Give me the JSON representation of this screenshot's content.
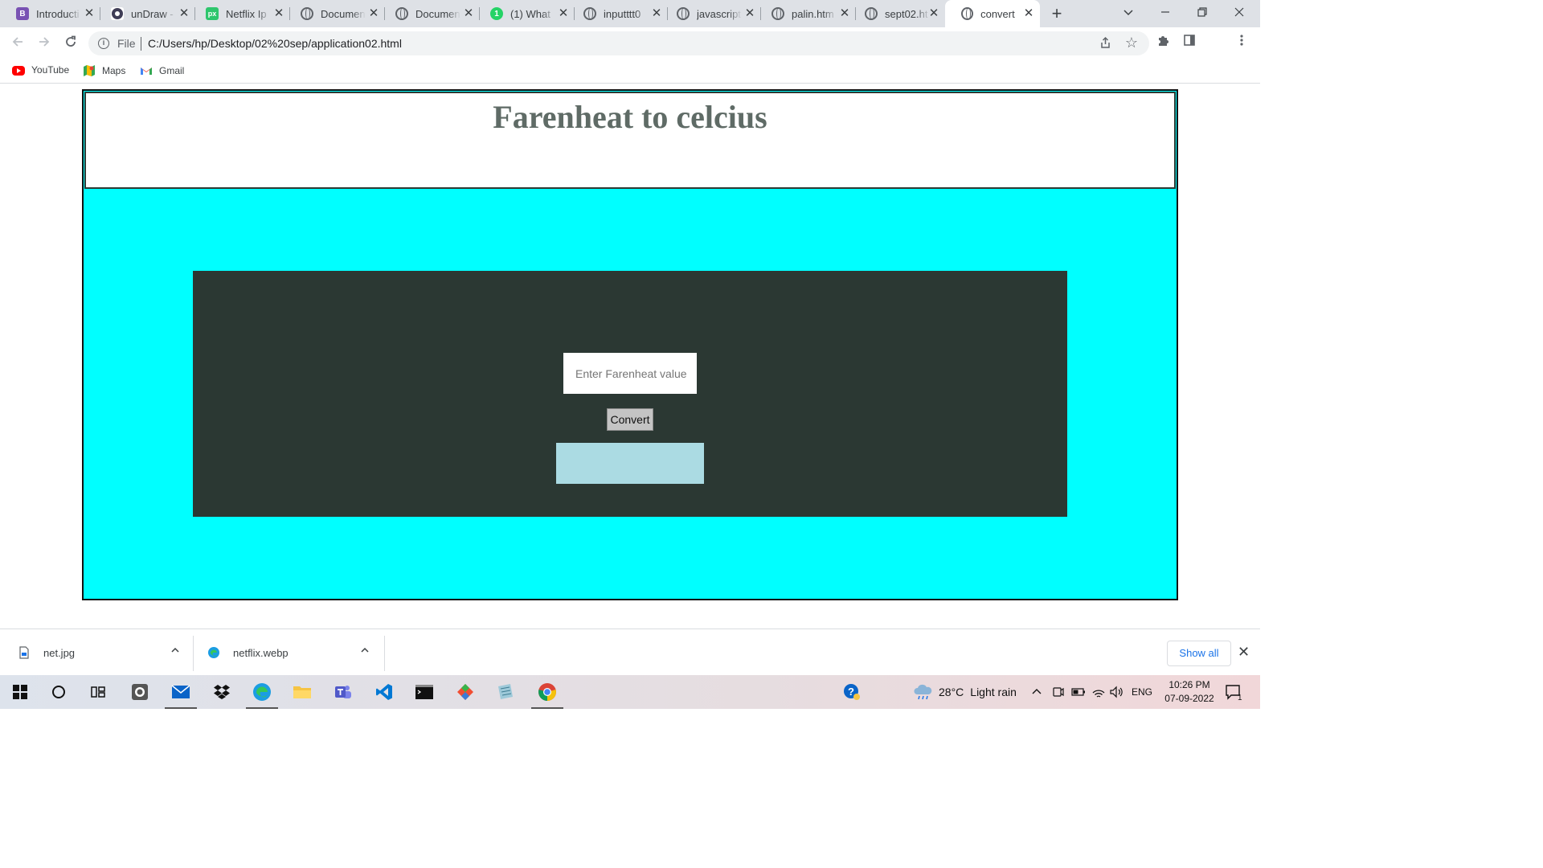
{
  "browser": {
    "tabs": [
      {
        "label": "Introducti",
        "icon": "bootstrap-icon",
        "color": "#7952b3"
      },
      {
        "label": "unDraw -",
        "icon": "undraw-icon",
        "color": "#3f3d56"
      },
      {
        "label": "Netflix Ip",
        "icon": "pixabay-icon",
        "color": "#2ec66d"
      },
      {
        "label": "Documen",
        "icon": "globe-icon"
      },
      {
        "label": "Documen",
        "icon": "globe-icon"
      },
      {
        "label": "(1) What",
        "icon": "whatsapp-icon",
        "color": "#25d366"
      },
      {
        "label": "inputttt0",
        "icon": "globe-icon"
      },
      {
        "label": "javascript",
        "icon": "globe-icon"
      },
      {
        "label": "palin.htm",
        "icon": "globe-icon"
      },
      {
        "label": "sept02.ht",
        "icon": "globe-icon"
      },
      {
        "label": "convert",
        "icon": "globe-icon",
        "active": true
      }
    ],
    "address": {
      "scheme_label": "File",
      "url": "C:/Users/hp/Desktop/02%20sep/application02.html"
    },
    "bookmarks": [
      {
        "label": "YouTube",
        "icon": "youtube-icon"
      },
      {
        "label": "Maps",
        "icon": "maps-icon"
      },
      {
        "label": "Gmail",
        "icon": "gmail-icon"
      }
    ]
  },
  "app": {
    "heading": "Farenheat to celcius",
    "input_placeholder": "Enter Farenheat value",
    "input_value": "",
    "convert_label": "Convert",
    "result_text": "",
    "colors": {
      "page_bg": "#00ffff",
      "panel_bg": "#2b3833",
      "heading_color": "#5f6b66",
      "result_bg": "#abdbe3"
    }
  },
  "downloads": {
    "items": [
      {
        "label": "net.jpg",
        "icon": "file-icon"
      },
      {
        "label": "netflix.webp",
        "icon": "edge-icon"
      }
    ],
    "show_all_label": "Show all"
  },
  "taskbar": {
    "weather": {
      "temp": "28°C",
      "condition": "Light rain"
    },
    "language": "ENG",
    "time": "10:26 PM",
    "date": "07-09-2022",
    "notification_count": "1"
  }
}
